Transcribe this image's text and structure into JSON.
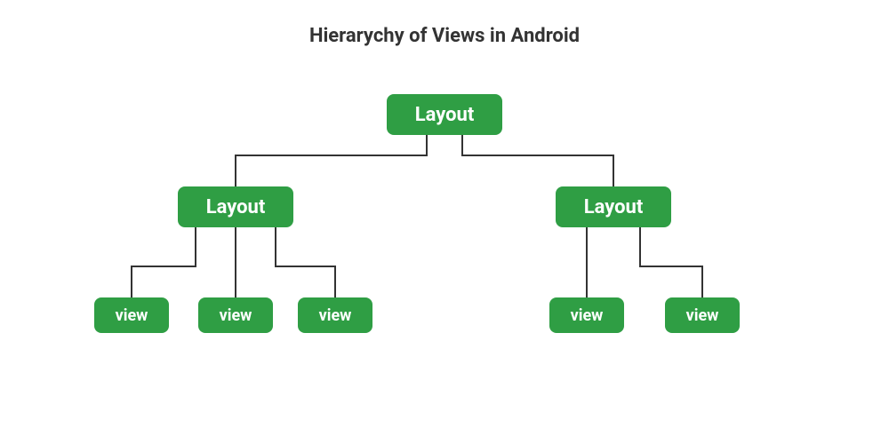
{
  "title": "Hierarychy of Views in Android",
  "colors": {
    "node_bg": "#2f9e44",
    "node_text": "#ffffff",
    "line": "#333333",
    "title": "#333333"
  },
  "tree": {
    "root": {
      "label": "Layout",
      "children": [
        {
          "label": "Layout",
          "children": [
            {
              "label": "view"
            },
            {
              "label": "view"
            },
            {
              "label": "view"
            }
          ]
        },
        {
          "label": "Layout",
          "children": [
            {
              "label": "view"
            },
            {
              "label": "view"
            }
          ]
        }
      ]
    }
  }
}
